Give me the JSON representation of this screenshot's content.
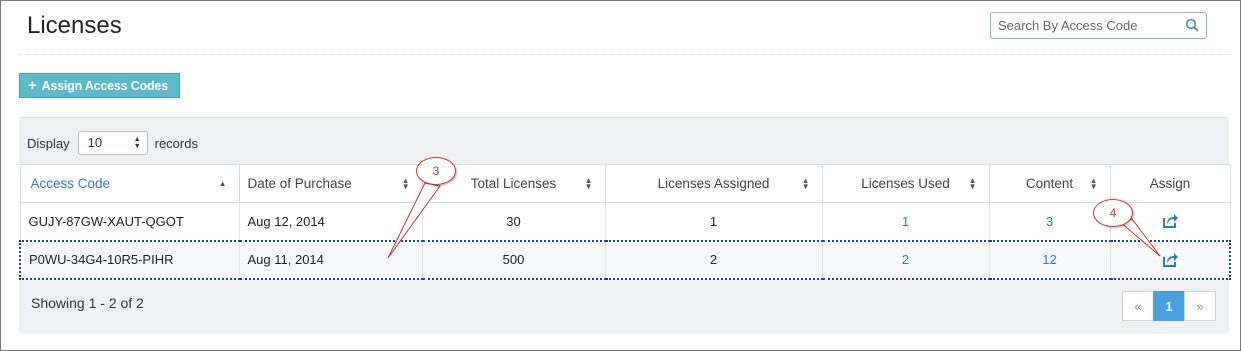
{
  "page": {
    "title": "Licenses"
  },
  "search": {
    "placeholder": "Search By Access Code",
    "icon": "search-icon"
  },
  "toolbar": {
    "assign_label": "Assign Access Codes",
    "assign_icon": "plus-icon",
    "accent": "#5bb9c9"
  },
  "display": {
    "prefix": "Display",
    "value": "10",
    "suffix": "records"
  },
  "table": {
    "columns": [
      {
        "label": "Access Code",
        "sort": "asc"
      },
      {
        "label": "Date of Purchase",
        "sort": "both"
      },
      {
        "label": "Total Licenses",
        "sort": "both"
      },
      {
        "label": "Licenses Assigned",
        "sort": "both"
      },
      {
        "label": "Licenses Used",
        "sort": "both"
      },
      {
        "label": "Content",
        "sort": "both"
      },
      {
        "label": "Assign",
        "sort": "none"
      }
    ],
    "rows": [
      {
        "access_code": "GUJY-87GW-XAUT-QGOT",
        "date": "Aug 12, 2014",
        "total": "30",
        "assigned": "1",
        "used": "1",
        "content": "3",
        "assign_icon": "share-icon"
      },
      {
        "access_code": "P0WU-34G4-10R5-PIHR",
        "date": "Aug 11, 2014",
        "total": "500",
        "assigned": "2",
        "used": "2",
        "content": "12",
        "assign_icon": "share-icon"
      }
    ]
  },
  "footer": {
    "showing": "Showing 1 - 2 of 2"
  },
  "pagination": {
    "prev": "«",
    "current": "1",
    "next": "»"
  },
  "callouts": [
    {
      "label": "3"
    },
    {
      "label": "4"
    }
  ],
  "colors": {
    "link": "#2b7bbf",
    "active_page": "#4aa0dc",
    "callout": "#c53a2a"
  }
}
